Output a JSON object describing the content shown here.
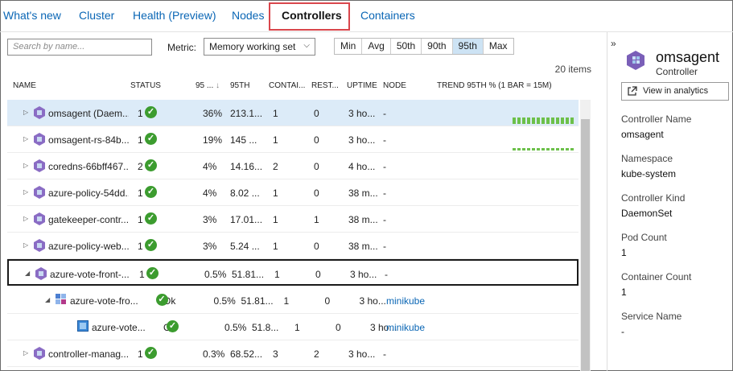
{
  "tabs": [
    {
      "label": "What's new",
      "active": false
    },
    {
      "label": "Cluster",
      "active": false
    },
    {
      "label": "Health (Preview)",
      "active": false
    },
    {
      "label": "Nodes",
      "active": false
    },
    {
      "label": "Controllers",
      "active": true
    },
    {
      "label": "Containers",
      "active": false
    }
  ],
  "filter": {
    "search_placeholder": "Search by name...",
    "metric_label": "Metric:",
    "metric_value": "Memory working set",
    "percentiles": [
      "Min",
      "Avg",
      "50th",
      "90th",
      "95th",
      "Max"
    ],
    "selected_percentile": "95th",
    "item_count": "20 items"
  },
  "table": {
    "columns": [
      "NAME",
      "STATUS",
      "95 ...",
      "95TH",
      "CONTAI...",
      "REST...",
      "UPTIME",
      "NODE",
      "TREND 95TH % (1 BAR = 15M)"
    ],
    "rows": [
      {
        "name": "omsagent (Daem...",
        "status": "1",
        "pct": "36%",
        "val": "213.1...",
        "containers": "1",
        "restarts": "0",
        "uptime": "3 ho...",
        "node": "-"
      },
      {
        "name": "omsagent-rs-84b...",
        "status": "1",
        "pct": "19%",
        "val": "145 ...",
        "containers": "1",
        "restarts": "0",
        "uptime": "3 ho...",
        "node": "-"
      },
      {
        "name": "coredns-66bff467...",
        "status": "2",
        "pct": "4%",
        "val": "14.16...",
        "containers": "2",
        "restarts": "0",
        "uptime": "4 ho...",
        "node": "-"
      },
      {
        "name": "azure-policy-54dd...",
        "status": "1",
        "pct": "4%",
        "val": "8.02 ...",
        "containers": "1",
        "restarts": "0",
        "uptime": "38 m...",
        "node": "-"
      },
      {
        "name": "gatekeeper-contr...",
        "status": "1",
        "pct": "3%",
        "val": "17.01...",
        "containers": "1",
        "restarts": "1",
        "uptime": "38 m...",
        "node": "-"
      },
      {
        "name": "azure-policy-web...",
        "status": "1",
        "pct": "3%",
        "val": "5.24 ...",
        "containers": "1",
        "restarts": "0",
        "uptime": "38 m...",
        "node": "-"
      },
      {
        "name": "azure-vote-front-...",
        "status": "1",
        "pct": "0.5%",
        "val": "51.81...",
        "containers": "1",
        "restarts": "0",
        "uptime": "3 ho...",
        "node": "-"
      },
      {
        "name": "azure-vote-fro...",
        "status": "Ok",
        "pct": "0.5%",
        "val": "51.81...",
        "containers": "1",
        "restarts": "0",
        "uptime": "3 ho...",
        "node": "minikube"
      },
      {
        "name": "azure-vote...",
        "status": "Ok",
        "pct": "0.5%",
        "val": "51.8...",
        "containers": "1",
        "restarts": "0",
        "uptime": "3 ho...",
        "node": "minikube"
      },
      {
        "name": "controller-manag...",
        "status": "1",
        "pct": "0.3%",
        "val": "68.52...",
        "containers": "3",
        "restarts": "2",
        "uptime": "3 ho...",
        "node": "-"
      }
    ]
  },
  "panel": {
    "title": "omsagent",
    "subtitle": "Controller",
    "view_button": "View in analytics",
    "fields": [
      {
        "label": "Controller Name",
        "value": "omsagent"
      },
      {
        "label": "Namespace",
        "value": "kube-system"
      },
      {
        "label": "Controller Kind",
        "value": "DaemonSet"
      },
      {
        "label": "Pod Count",
        "value": "1"
      },
      {
        "label": "Container Count",
        "value": "1"
      },
      {
        "label": "Service Name",
        "value": "-"
      }
    ]
  },
  "colors": {
    "accent": "#0a66b5",
    "ok": "#3c9c2f",
    "highlight": "#d9464c",
    "selected_row": "#dcebf8",
    "trend_bar": "#6cc04a"
  },
  "icons": [
    "collapse-panel-icon",
    "pod-icon",
    "replicaset-icon",
    "container-icon",
    "check-circle-icon",
    "expand-arrow-icon",
    "external-link-icon",
    "sort-arrow-icon",
    "dropdown-chevron-icon"
  ]
}
